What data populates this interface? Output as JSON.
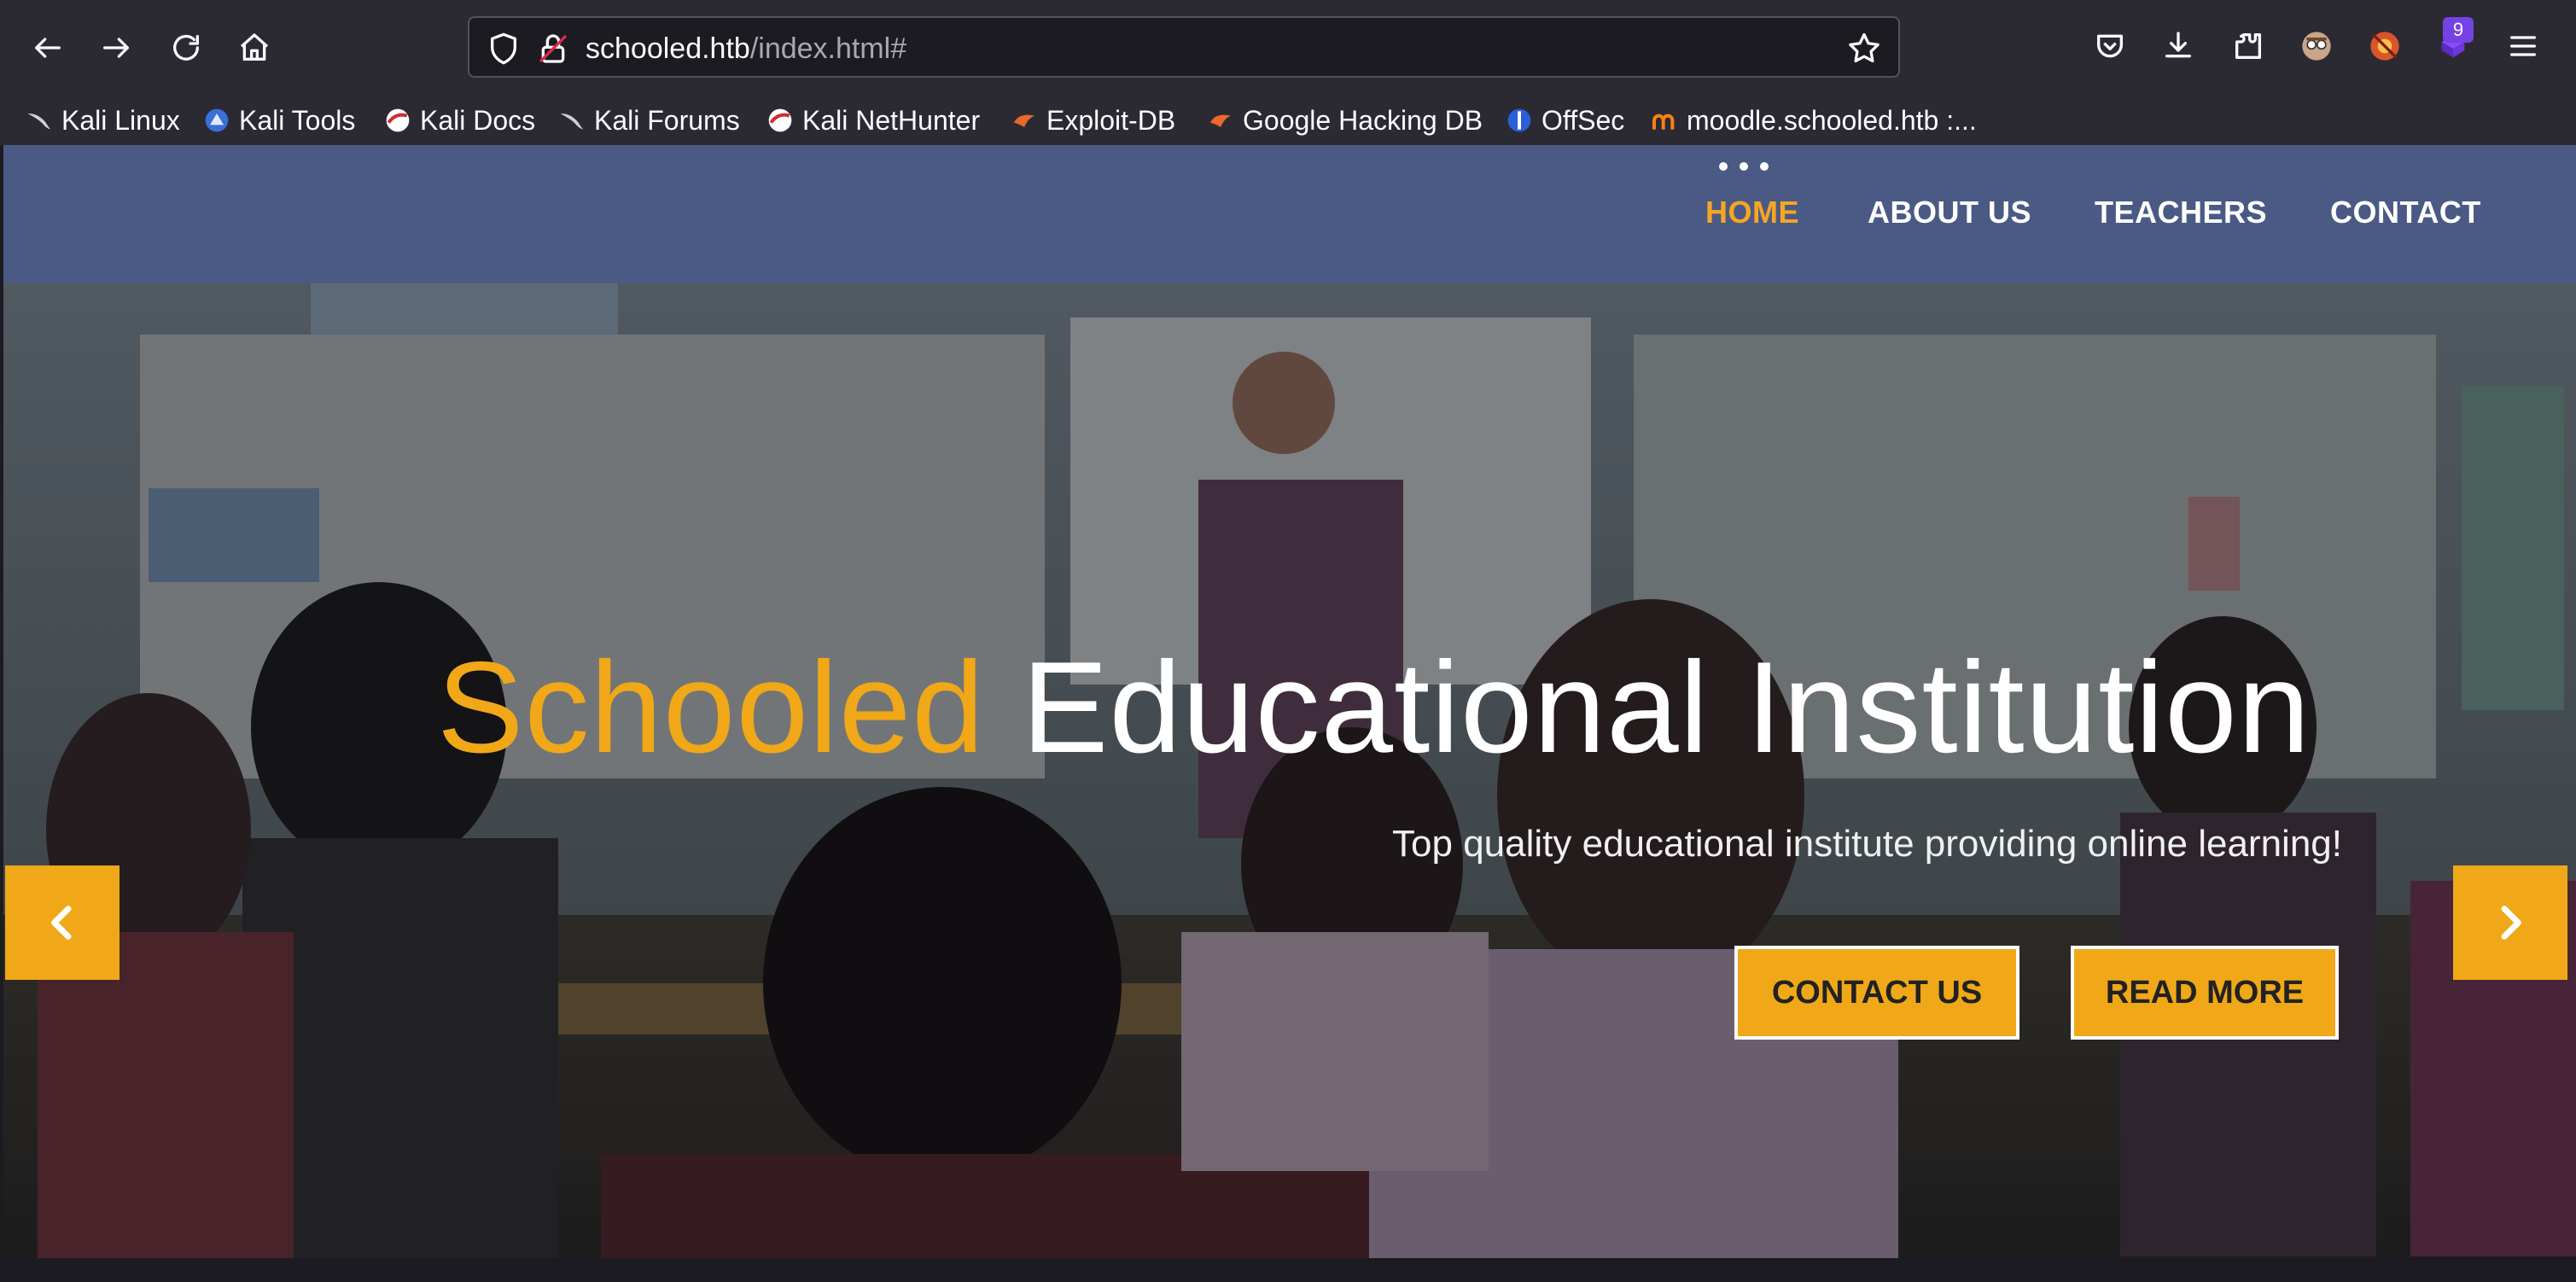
{
  "browser": {
    "url_host": "schooled.htb",
    "url_path": "/index.html#",
    "extension_badge": "9",
    "icons": [
      "back-arrow-icon",
      "forward-arrow-icon",
      "reload-icon",
      "home-icon",
      "shield-icon",
      "lock-icon",
      "star-icon",
      "pocket-icon",
      "download-icon",
      "extensions-icon",
      "profile-icon",
      "extension-icon",
      "extension-icon",
      "menu-icon"
    ]
  },
  "bookmarks": [
    {
      "label": "Kali Linux"
    },
    {
      "label": "Kali Tools"
    },
    {
      "label": "Kali Docs"
    },
    {
      "label": "Kali Forums"
    },
    {
      "label": "Kali NetHunter"
    },
    {
      "label": "Exploit-DB"
    },
    {
      "label": "Google Hacking DB"
    },
    {
      "label": "OffSec"
    },
    {
      "label": "moodle.schooled.htb :..."
    }
  ],
  "site": {
    "nav": {
      "home": "HOME",
      "about": "ABOUT US",
      "teachers": "TEACHERS",
      "contact": "CONTACT"
    },
    "hero": {
      "title_accent": "Schooled",
      "title_rest": "Educational Institution",
      "subtitle": "Top quality educational institute providing online learning!",
      "contact_button": "CONTACT US",
      "read_more_button": "READ MORE"
    },
    "colors": {
      "accent": "#f0a818",
      "header_bg": "#4b5a85",
      "chrome_bg": "#2b2a33"
    }
  }
}
